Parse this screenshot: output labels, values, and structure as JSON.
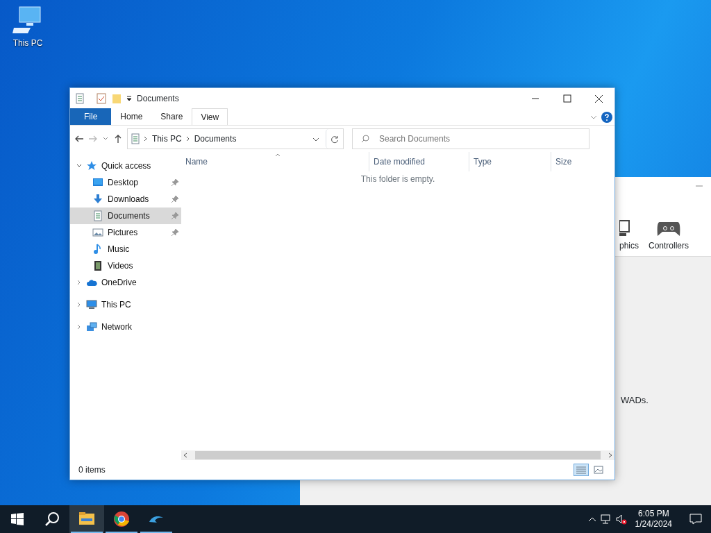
{
  "desktop_icons": [
    {
      "label": "This PC"
    }
  ],
  "background_window": {
    "toolbar": [
      {
        "label": "phics",
        "kind": "monitor"
      },
      {
        "label": "Controllers",
        "kind": "gamepad"
      }
    ],
    "text_1": "WADs."
  },
  "explorer": {
    "title": "Documents",
    "ribbon_tabs": [
      {
        "label": "File",
        "kind": "file",
        "hovered": false
      },
      {
        "label": "Home",
        "kind": "tab",
        "hovered": false
      },
      {
        "label": "Share",
        "kind": "tab",
        "hovered": false
      },
      {
        "label": "View",
        "kind": "tab",
        "hovered": true
      }
    ],
    "address": {
      "crumbs": [
        "This PC",
        "Documents"
      ]
    },
    "search": {
      "placeholder": "Search Documents"
    },
    "columns": [
      {
        "label": "Name",
        "sorted": true
      },
      {
        "label": "Date modified",
        "sorted": false
      },
      {
        "label": "Type",
        "sorted": false
      },
      {
        "label": "Size",
        "sorted": false
      }
    ],
    "empty_message": "This folder is empty.",
    "nav": [
      {
        "label": "Quick access",
        "kind": "star",
        "expanded": true,
        "selected": false,
        "children": [
          {
            "label": "Desktop",
            "kind": "desktop",
            "pinned": true,
            "selected": false
          },
          {
            "label": "Downloads",
            "kind": "download",
            "pinned": true,
            "selected": false
          },
          {
            "label": "Documents",
            "kind": "document",
            "pinned": true,
            "selected": true
          },
          {
            "label": "Pictures",
            "kind": "pictures",
            "pinned": true,
            "selected": false
          },
          {
            "label": "Music",
            "kind": "music",
            "pinned": false,
            "selected": false
          },
          {
            "label": "Videos",
            "kind": "videos",
            "pinned": false,
            "selected": false
          }
        ]
      },
      {
        "label": "OneDrive",
        "kind": "cloud",
        "expanded": false,
        "selected": false
      },
      {
        "label": "This PC",
        "kind": "pc",
        "expanded": false,
        "selected": false
      },
      {
        "label": "Network",
        "kind": "network",
        "expanded": false,
        "selected": false
      }
    ],
    "status": "0 items",
    "view_modes": [
      {
        "kind": "details",
        "selected": true
      },
      {
        "kind": "tiles",
        "selected": false
      }
    ]
  },
  "taskbar": {
    "apps": [
      {
        "kind": "explorer",
        "running": true,
        "active": true
      },
      {
        "kind": "chrome",
        "running": true,
        "active": false
      },
      {
        "kind": "dolphin",
        "running": true,
        "active": false
      }
    ],
    "time": "6:05 PM",
    "date": "1/24/2024"
  }
}
